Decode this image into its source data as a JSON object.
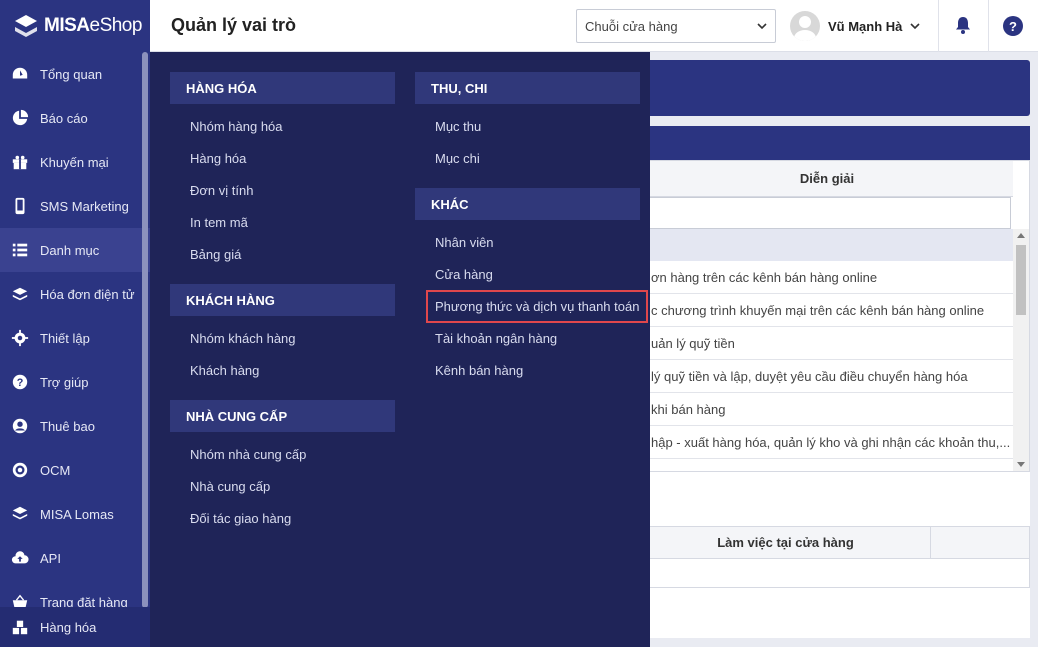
{
  "app": {
    "logo_bold": "MISA",
    "logo_rest": "eShop"
  },
  "header": {
    "title": "Quản lý vai trò",
    "store_select": "Chuỗi cửa hàng",
    "user_name": "Vũ Mạnh Hà",
    "help": "?"
  },
  "sidebar": {
    "items": [
      {
        "label": "Tổng quan",
        "icon": "dashboard-icon"
      },
      {
        "label": "Báo cáo",
        "icon": "pie-chart-icon"
      },
      {
        "label": "Khuyến mại",
        "icon": "gift-icon"
      },
      {
        "label": "SMS Marketing",
        "icon": "phone-icon"
      },
      {
        "label": "Danh mục",
        "icon": "list-icon"
      },
      {
        "label": "Hóa đơn điện tử",
        "icon": "invoice-icon"
      },
      {
        "label": "Thiết lập",
        "icon": "gear-icon"
      },
      {
        "label": "Trợ giúp",
        "icon": "help-icon"
      },
      {
        "label": "Thuê bao",
        "icon": "user-circle-icon"
      },
      {
        "label": "OCM",
        "icon": "ocm-icon"
      },
      {
        "label": "MISA Lomas",
        "icon": "layers-icon"
      },
      {
        "label": "API",
        "icon": "cloud-upload-icon"
      },
      {
        "label": "Trang đặt hàng",
        "icon": "basket-icon"
      }
    ],
    "bottom": {
      "label": "Hàng hóa",
      "icon": "boxes-icon"
    }
  },
  "menu": {
    "col1": [
      {
        "title": "HÀNG HÓA",
        "items": [
          "Nhóm hàng hóa",
          "Hàng hóa",
          "Đơn vị tính",
          "In tem mã",
          "Bảng giá"
        ]
      },
      {
        "title": "KHÁCH HÀNG",
        "items": [
          "Nhóm khách hàng",
          "Khách hàng"
        ]
      },
      {
        "title": "NHÀ CUNG CẤP",
        "items": [
          "Nhóm nhà cung cấp",
          "Nhà cung cấp",
          "Đối tác giao hàng"
        ]
      }
    ],
    "col2": [
      {
        "title": "THU, CHI",
        "items": [
          "Mục thu",
          "Mục chi"
        ]
      },
      {
        "title": "KHÁC",
        "items": [
          "Nhân viên",
          "Cửa hàng",
          "Phương thức và dịch vụ thanh toán",
          "Tài khoản ngân hàng",
          "Kênh bán hàng"
        ]
      }
    ]
  },
  "background": {
    "desc_header": "Diễn giải",
    "rows": [
      "ơn hàng trên các kênh bán hàng online",
      "c chương trình khuyến mại trên các kênh bán hàng online",
      "uản lý quỹ tiền",
      "lý quỹ tiền và lập, duyệt yêu cầu điều chuyển hàng hóa",
      "khi bán hàng",
      "hập - xuất hàng hóa, quản lý kho và ghi nhận các khoản thu,..."
    ],
    "work_header": "Làm việc tại cửa hàng"
  }
}
